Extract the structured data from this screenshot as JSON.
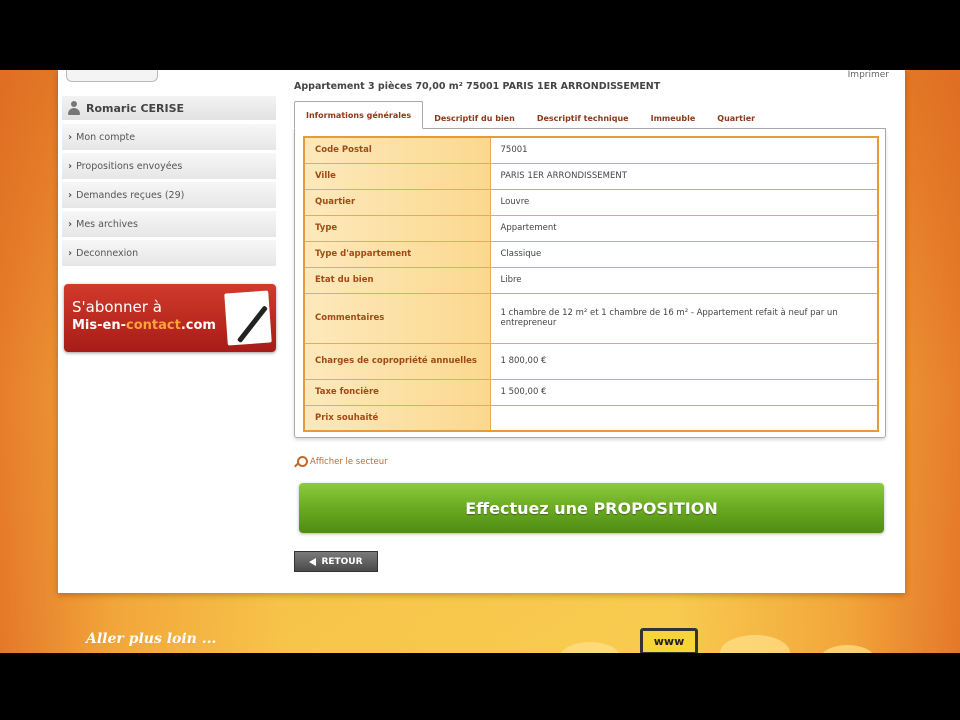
{
  "sidebar": {
    "user_name": "Romaric CERISE",
    "menu": [
      {
        "label": "Mon compte"
      },
      {
        "label": "Propositions envoyées"
      },
      {
        "label": "Demandes reçues (29)"
      },
      {
        "label": "Mes archives"
      },
      {
        "label": "Deconnexion"
      }
    ],
    "promo": {
      "line1": "S'abonner à",
      "brand_a": "Mis-en-",
      "brand_b": "contact",
      "brand_c": ".com"
    }
  },
  "header": {
    "title": "Appartement 3 pièces 70,00 m² 75001 PARIS 1ER ARRONDISSEMENT",
    "print_label": "Imprimer"
  },
  "tabs": [
    {
      "label": "Informations générales",
      "active": true
    },
    {
      "label": "Descriptif du bien",
      "active": false
    },
    {
      "label": "Descriptif technique",
      "active": false
    },
    {
      "label": "Immeuble",
      "active": false
    },
    {
      "label": "Quartier",
      "active": false
    }
  ],
  "details": [
    {
      "key": "Code Postal",
      "value": "75001"
    },
    {
      "key": "Ville",
      "value": "PARIS 1ER ARRONDISSEMENT"
    },
    {
      "key": "Quartier",
      "value": "Louvre"
    },
    {
      "key": "Type",
      "value": "Appartement"
    },
    {
      "key": "Type d'appartement",
      "value": "Classique"
    },
    {
      "key": "Etat du bien",
      "value": "Libre"
    },
    {
      "key": "Commentaires",
      "value": "1 chambre de 12 m² et 1 chambre de 16 m² - Appartement refait à neuf par un entrepreneur"
    },
    {
      "key": "Charges de copropriété annuelles",
      "value": "1 800,00 €"
    },
    {
      "key": "Taxe foncière",
      "value": "1 500,00 €"
    },
    {
      "key": "Prix souhaité",
      "value": ""
    }
  ],
  "actions": {
    "show_sector": "Afficher le secteur",
    "proposal_button": "Effectuez une PROPOSITION",
    "back_button": "RETOUR"
  },
  "footer": {
    "title": "Aller plus loin ...",
    "www_badge": "www"
  },
  "colors": {
    "accent_orange": "#e79a3a",
    "label_brown": "#a24a16",
    "cta_green": "#6aaa22",
    "promo_red": "#b82620"
  }
}
